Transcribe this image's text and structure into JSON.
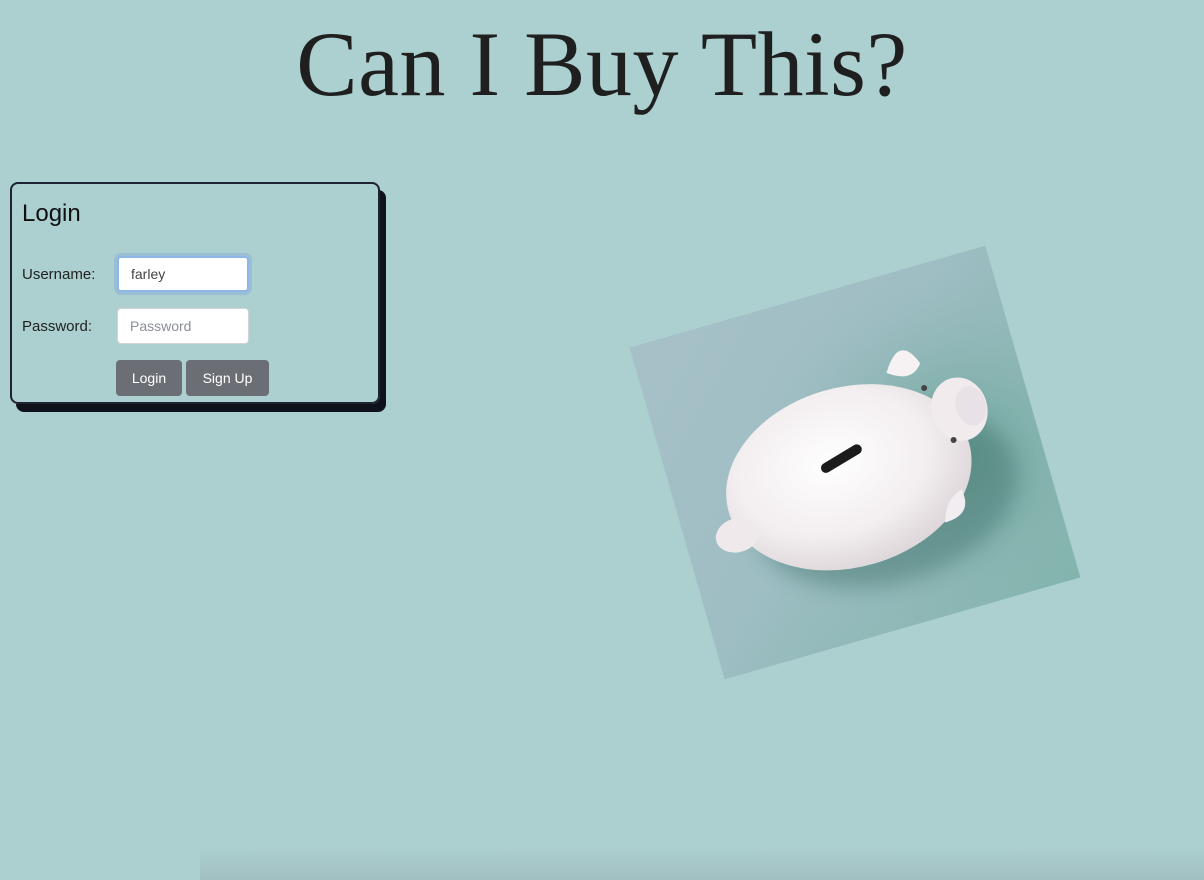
{
  "page": {
    "title": "Can I Buy This?",
    "background_color": "#accfcf"
  },
  "login": {
    "heading": "Login",
    "username_label": "Username:",
    "username_value": "farley",
    "password_label": "Password:",
    "password_placeholder": "Password",
    "login_button": "Login",
    "signup_button": "Sign Up",
    "button_color": "#6b6f75"
  },
  "hero_image": {
    "icon": "piggy-bank-photo"
  }
}
